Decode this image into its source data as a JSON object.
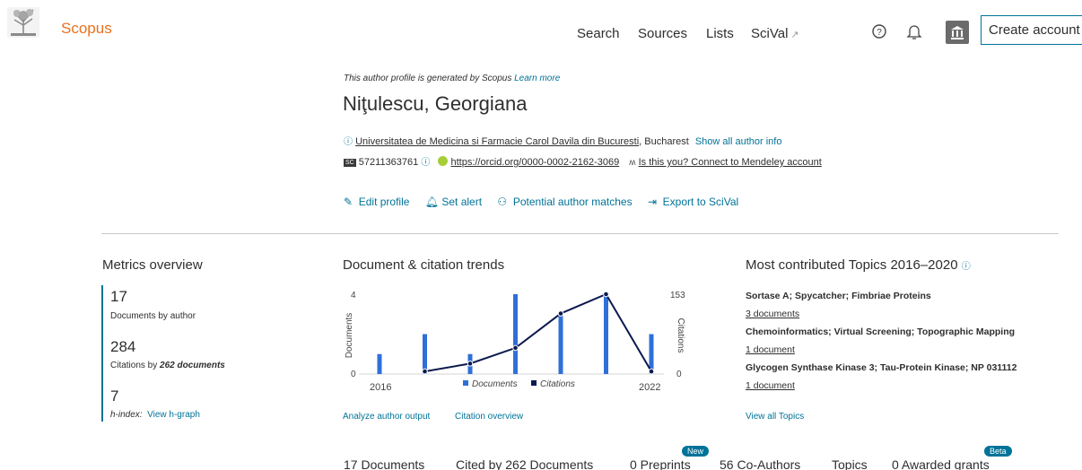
{
  "header": {
    "brand": "Scopus",
    "nav": [
      {
        "label": "Search"
      },
      {
        "label": "Sources"
      },
      {
        "label": "Lists"
      },
      {
        "label": "SciVal",
        "ext": "↗"
      }
    ],
    "create_account": "Create account"
  },
  "author": {
    "disclaimer": "This author profile is generated by Scopus",
    "learn_more": "Learn more",
    "name": "Niţulescu, Georgiana",
    "affiliation": "Universitatea de Medicina si Farmacie Carol Davila din Bucuresti",
    "city": ", Bucharest",
    "show_all": "Show all author info",
    "scopus_id": "57211363761",
    "sc_label": "SC",
    "orcid_url": "https://orcid.org/0000-0002-2162-3069",
    "mendeley": "Is this you? Connect to Mendeley account"
  },
  "actions": {
    "edit": "Edit profile",
    "alert": "Set alert",
    "matches": "Potential author matches",
    "export": "Export to SciVal"
  },
  "metrics": {
    "title": "Metrics overview",
    "documents": "17",
    "documents_label": "Documents by author",
    "citations": "284",
    "citations_label_pre": "Citations by ",
    "citations_label_bold": "262 documents",
    "hindex": "7",
    "hindex_label": "h-index:",
    "hgraph": "View h-graph"
  },
  "trends": {
    "title": "Document & citation trends",
    "analyze": "Analyze author output",
    "citation_overview": "Citation overview"
  },
  "chart_data": {
    "type": "bar",
    "x_range": [
      "2016",
      "2022"
    ],
    "years": [
      2016,
      2017,
      2018,
      2019,
      2020,
      2021,
      2022
    ],
    "series": [
      {
        "name": "Documents",
        "axis": "left",
        "kind": "bar",
        "color": "#2f6fd8",
        "values": [
          1,
          2,
          1,
          4,
          3,
          4,
          2
        ]
      },
      {
        "name": "Citations",
        "axis": "right",
        "kind": "line",
        "color": "#0b1a4f",
        "values": [
          null,
          5,
          20,
          50,
          116,
          153,
          5
        ]
      }
    ],
    "ylabel_left": "Documents",
    "ylabel_right": "Citations",
    "ylim_left": [
      0,
      4
    ],
    "ylim_right": [
      0,
      153
    ],
    "left_ticks": [
      "4",
      "0"
    ],
    "right_ticks": [
      "153",
      "0"
    ],
    "x_ticks": [
      "2016",
      "2022"
    ],
    "legend": [
      "Documents",
      "Citations"
    ]
  },
  "topics": {
    "title": "Most contributed Topics 2016–2020",
    "items": [
      {
        "name": "Sortase A; Spycatcher; Fimbriae Proteins",
        "docs": "3 documents"
      },
      {
        "name": "Chemoinformatics; Virtual Screening; Topographic Mapping",
        "docs": "1 document"
      },
      {
        "name": "Glycogen Synthase Kinase 3; Tau-Protein Kinase; NP 031112",
        "docs": "1 document"
      }
    ],
    "view_all": "View all Topics"
  },
  "tabs": [
    {
      "label": "17 Documents"
    },
    {
      "label": "Cited by 262 Documents"
    },
    {
      "label": "0 Preprints",
      "badge": "New"
    },
    {
      "label": "56 Co-Authors"
    },
    {
      "label": "Topics"
    },
    {
      "label": "0 Awarded grants",
      "badge": "Beta"
    }
  ]
}
